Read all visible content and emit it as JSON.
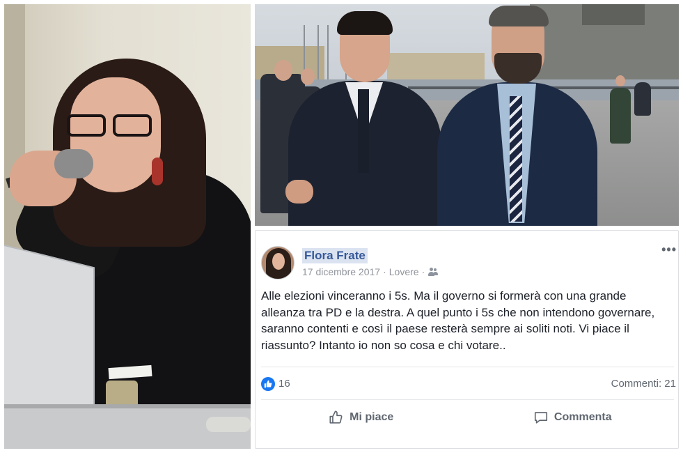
{
  "post": {
    "author": "Flora Frate",
    "date": "17 dicembre 2017",
    "location": "Lovere",
    "separator": "·",
    "audience_icon": "friends-icon",
    "more_icon": "more-options-icon",
    "more_label": "•••",
    "text": "Alle elezioni vinceranno i 5s. Ma il governo si formerà con una grande alleanza tra PD e la destra. A quel punto i 5s che non intendono governare, saranno contenti e così il paese resterà sempre ai soliti noti. Vi piace il riassunto? Intanto io non so cosa e chi votare..",
    "reactions": {
      "icon": "like-reaction-icon",
      "count": "16",
      "color": "#1877f2"
    },
    "comments_label": "Commenti: 21",
    "actions": [
      {
        "label": "Mi piace",
        "icon": "thumbs-up-icon"
      },
      {
        "label": "Commenta",
        "icon": "comment-bubble-icon"
      }
    ]
  },
  "colors": {
    "author_name": "#365899",
    "author_highlight": "#dbe3f1",
    "meta_text": "#90949c",
    "body_text": "#1d2129",
    "action_text": "#606770"
  }
}
